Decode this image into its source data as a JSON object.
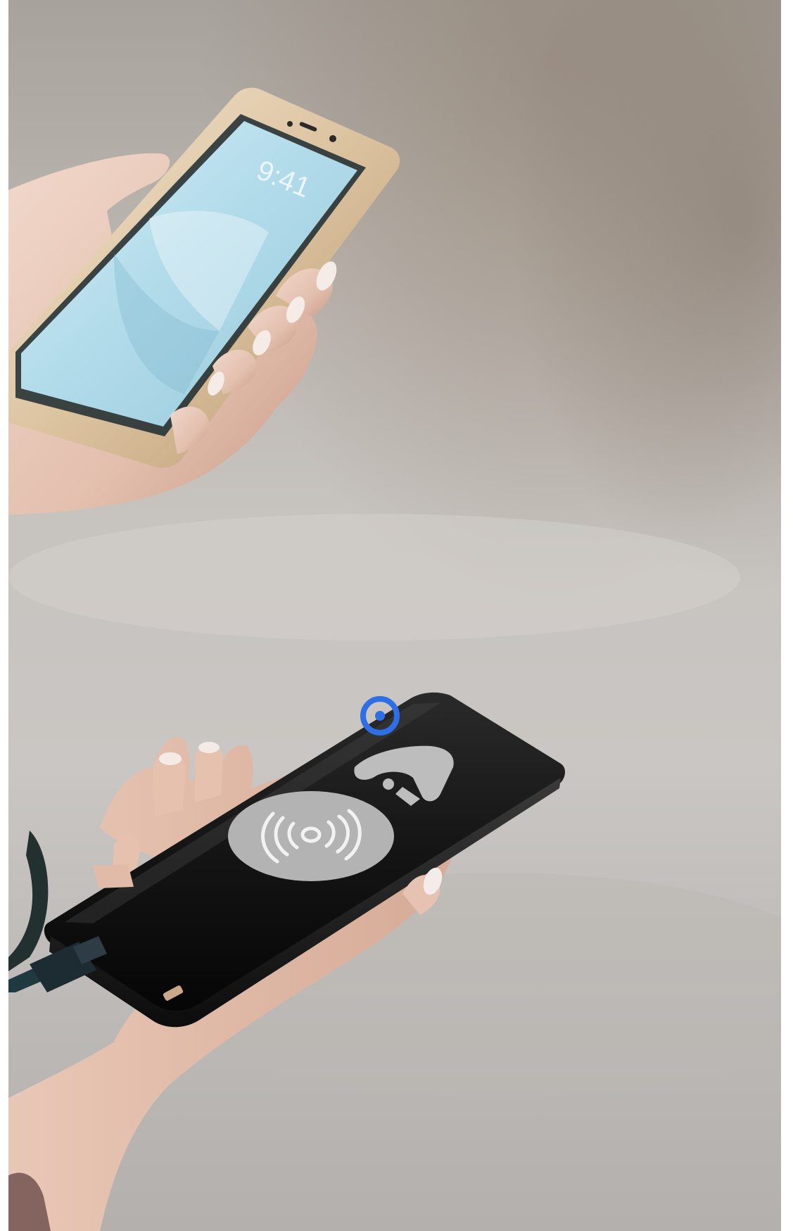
{
  "photo": {
    "phone": {
      "lock_screen_time": "9:41"
    },
    "power_bank": {
      "logo_icon": "brand-logo-icon",
      "wireless_icon": "wireless-charging-icon"
    }
  },
  "marker": {
    "icon": "click-target-marker-icon",
    "color": "#2f6fe6"
  }
}
